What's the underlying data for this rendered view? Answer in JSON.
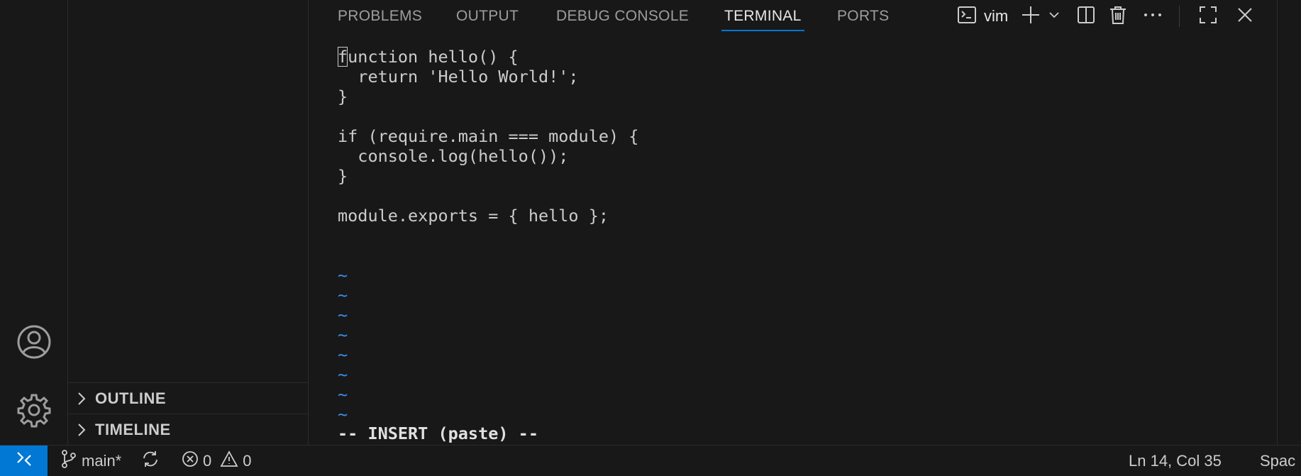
{
  "activity_bar": {
    "accounts_icon": "account-circle-icon",
    "manage_icon": "gear-icon"
  },
  "side_panel": {
    "sections": [
      {
        "label": "OUTLINE",
        "icon": "chevron-right-icon"
      },
      {
        "label": "TIMELINE",
        "icon": "chevron-right-icon"
      }
    ]
  },
  "panel": {
    "tabs": [
      {
        "label": "PROBLEMS",
        "active": false
      },
      {
        "label": "OUTPUT",
        "active": false
      },
      {
        "label": "DEBUG CONSOLE",
        "active": false
      },
      {
        "label": "TERMINAL",
        "active": true
      },
      {
        "label": "PORTS",
        "active": false
      }
    ],
    "toolbar": {
      "terminal_name": "vim",
      "icons": [
        "terminal-icon",
        "plus-icon",
        "chevron-down-icon",
        "split-icon",
        "trash-icon",
        "ellipsis-icon",
        "maximize-icon",
        "close-icon"
      ]
    }
  },
  "terminal": {
    "cursor_char": "f",
    "lines": [
      "unction hello() {",
      "  return 'Hello World!';",
      "}",
      "",
      "if (require.main === module) {",
      "  console.log(hello());",
      "}",
      "",
      "module.exports = { hello };"
    ],
    "tilde": "~",
    "tilde_count": 8,
    "mode_line": "-- INSERT (paste) --"
  },
  "status_bar": {
    "remote_icon": "remote-icon",
    "branch": "main*",
    "branch_icon": "source-control-icon",
    "sync_icon": "sync-icon",
    "errors": "0",
    "warnings": "0",
    "error_icon": "error-icon",
    "warning_icon": "warning-icon",
    "position": "Ln 14, Col 35",
    "indent": "Spac"
  },
  "colors": {
    "accent": "#0078d4",
    "tilde": "#3b8eea",
    "background": "#181818",
    "text": "#cccccc"
  }
}
